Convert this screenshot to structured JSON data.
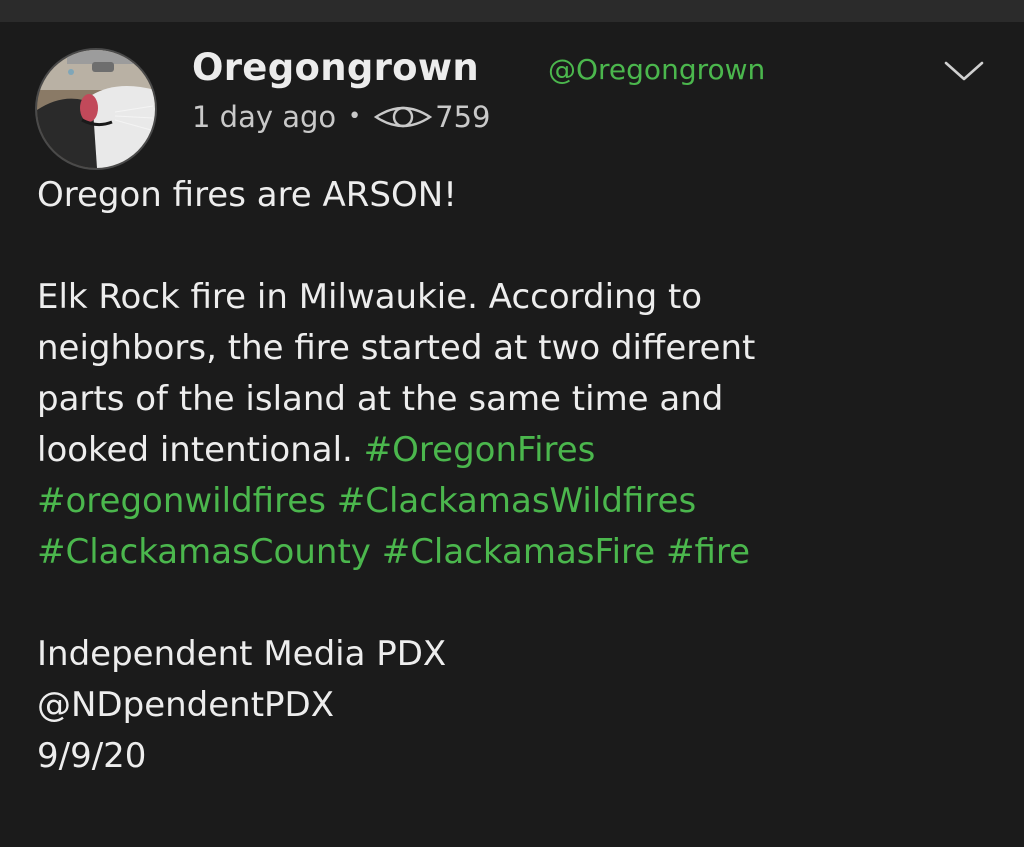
{
  "post": {
    "author": {
      "display_name": "Oregongrown",
      "handle": "@Oregongrown"
    },
    "time_ago": "1 day ago",
    "separator": "•",
    "views": "759",
    "body": {
      "line1": "Oregon fires are ARSON!",
      "line2": "Elk Rock fire in Milwaukie. According to",
      "line3": "neighbors, the fire started at two different",
      "line4": "parts of the island at the same time and",
      "line5_text": "looked intentional.",
      "hashtags": [
        "#OregonFires",
        "#oregonwildfires",
        "#ClackamasWildfires",
        "#ClackamasCounty",
        "#ClackamasFire",
        "#fire"
      ],
      "source_name": "Independent Media PDX",
      "source_handle": "@NDpendentPDX",
      "source_date": "9/9/20"
    }
  },
  "icons": {
    "avatar": "cat-drinking-from-faucet-avatar",
    "views": "eye-icon",
    "menu": "chevron-down-icon"
  },
  "colors": {
    "background": "#1b1b1b",
    "text": "#ededed",
    "accent_green": "#4bb74d",
    "muted": "#c9c9c9"
  }
}
